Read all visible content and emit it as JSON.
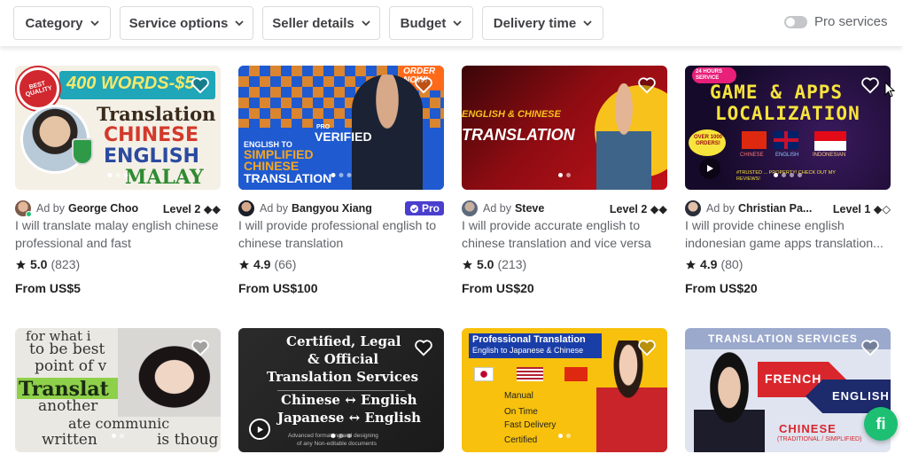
{
  "filters": {
    "category": "Category",
    "service_options": "Service options",
    "seller_details": "Seller details",
    "budget": "Budget",
    "delivery_time": "Delivery time",
    "pro_services": "Pro services"
  },
  "cards": [
    {
      "thumb": {
        "l1": "400 WORDS-$5",
        "l2": "Translation",
        "l3": "CHINESE",
        "l4": "ENGLISH",
        "l5": "MALAY",
        "badge": "BEST QUALITY",
        "seal": "TRUSTED SELLER"
      },
      "ad_by": "Ad by",
      "seller": "George Choo",
      "level": "Level 2 ◆◆",
      "title": "I will translate malay english chinese professional and fast",
      "rating": "5.0",
      "reviews": "(823)",
      "price": "From US$5"
    },
    {
      "thumb": {
        "l1": "ORDER NOW!",
        "l2": "PRO",
        "l3": "VERIFIED",
        "l4": "ENGLISH TO",
        "l5": "SIMPLIFIED CHINESE",
        "l6": "TRANSLATION"
      },
      "ad_by": "Ad by",
      "seller": "Bangyou Xiang",
      "pro": "Pro",
      "title": "I will provide professional english to chinese translation",
      "rating": "4.9",
      "reviews": "(66)",
      "price": "From US$100"
    },
    {
      "thumb": {
        "l1": "ENGLISH & CHINESE",
        "l2": "TRANSLATION"
      },
      "ad_by": "Ad by",
      "seller": "Steve",
      "level": "Level 2 ◆◆",
      "title": "I will provide accurate english to chinese translation and vice versa",
      "rating": "5.0",
      "reviews": "(213)",
      "price": "From US$20"
    },
    {
      "thumb": {
        "l1": "24 HOURS SERVICE",
        "l2": "GAME & APPS",
        "l3": "LOCALIZATION",
        "l4": "OVER 1000 ORDERS!",
        "l5": "CHINESE",
        "l6": "ENGLISH",
        "l7": "INDONESIAN",
        "l8": "#TRUSTED ... PROPERTY! CHECK OUT MY REVIEWS!"
      },
      "ad_by": "Ad by",
      "seller": "Christian Pa...",
      "level": "Level 1 ◆◇",
      "title": "I will provide chinese english indonesian game apps translation...",
      "rating": "4.9",
      "reviews": "(80)",
      "price": "From US$20"
    }
  ],
  "row2": [
    {
      "l1": "for what i",
      "l2": "to be best",
      "l3": "point of v",
      "l4": "Translat",
      "l5": "another",
      "l6": "ate communic",
      "l7": "written",
      "l8": "is thoug"
    },
    {
      "l1": "Certified, Legal",
      "l2": "& Official",
      "l3": "Translation Services",
      "l4": "Chinese ↔ English",
      "l5": "Japanese ↔ English",
      "l6": "Advanced formatting and designing",
      "l7": "of any Non-editable documents"
    },
    {
      "l1": "Professional Translation",
      "l2": "English to Japanese & Chinese",
      "l3": "Manual",
      "l4": "On Time",
      "l5": "Fast Delivery",
      "l6": "Certified"
    },
    {
      "l1": "TRANSLATION SERVICES",
      "l2": "FRENCH",
      "l3": "ENGLISH",
      "l4": "CHINESE",
      "l5": "(TRADITIONAL / SIMPLIFIED)"
    }
  ],
  "chat_icon": "fi",
  "colors": {
    "brand_green": "#1dbf73",
    "pro_purple": "#4a3ecf",
    "text_dark": "#222325",
    "text_muted": "#62646a"
  }
}
